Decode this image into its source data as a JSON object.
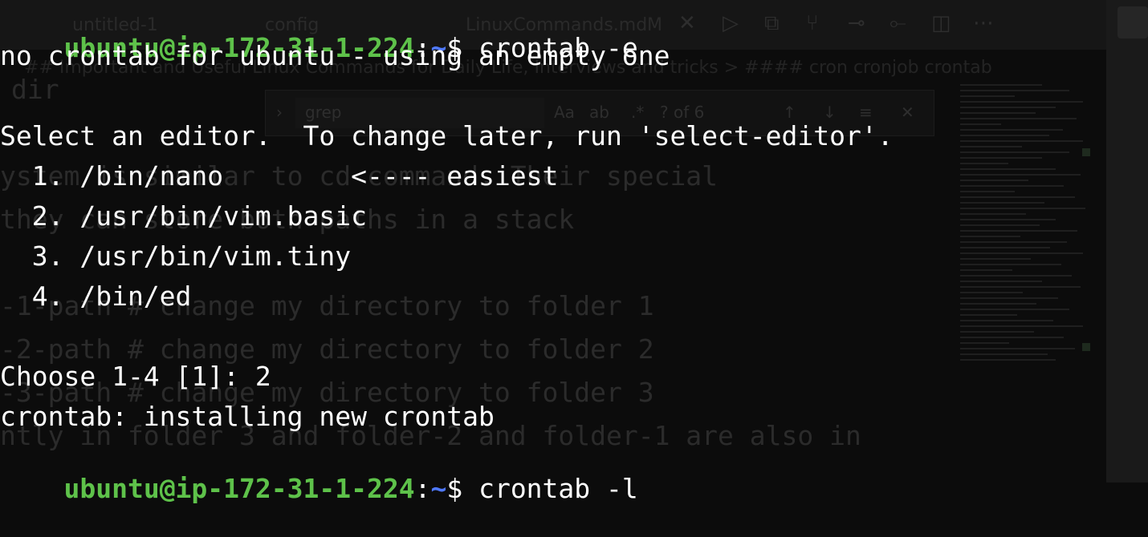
{
  "background_editor": {
    "tabs": [
      "untitled-1",
      "config",
      "LinuxCommands.md",
      "M"
    ],
    "breadcrumb": "## Important and Useful Linux Commands for Daily Life, Interviews and tricks  >  #### cron cronjob crontab",
    "find_widget": {
      "query": "grep",
      "match_case": "Aa",
      "whole_word": "ab",
      "regex": ".*",
      "result": "? of 6"
    },
    "code_lines": [
      "dir",
      "ystem is similar to cd command. Their special",
      " they can store both paths in a stack",
      "-1-path # change my directory to folder 1",
      "-2-path # change my directory to folder 2",
      "-3-path # change my directory to folder 3",
      "ntly in folder 3 and folder-2 and folder-1 are also in"
    ]
  },
  "terminal": {
    "prompt": {
      "user_host": "ubuntu@ip-172-31-1-224",
      "separator": ":",
      "path": "~",
      "symbol": "$ "
    },
    "lines": {
      "cmd1": "crontab -e",
      "out1": "no crontab for ubuntu - using an empty one",
      "out2": "Select an editor.  To change later, run 'select-editor'.",
      "opt1": "  1. /bin/nano        <---- easiest",
      "opt2": "  2. /usr/bin/vim.basic",
      "opt3": "  3. /usr/bin/vim.tiny",
      "opt4": "  4. /bin/ed",
      "choose": "Choose 1-4 [1]: 2",
      "install": "crontab: installing new crontab",
      "cmd2": "crontab -l"
    },
    "colors": {
      "background": "#0c0c0c",
      "text": "#ffffff",
      "user_host": "#5ec24a",
      "path": "#4f79ff"
    }
  }
}
